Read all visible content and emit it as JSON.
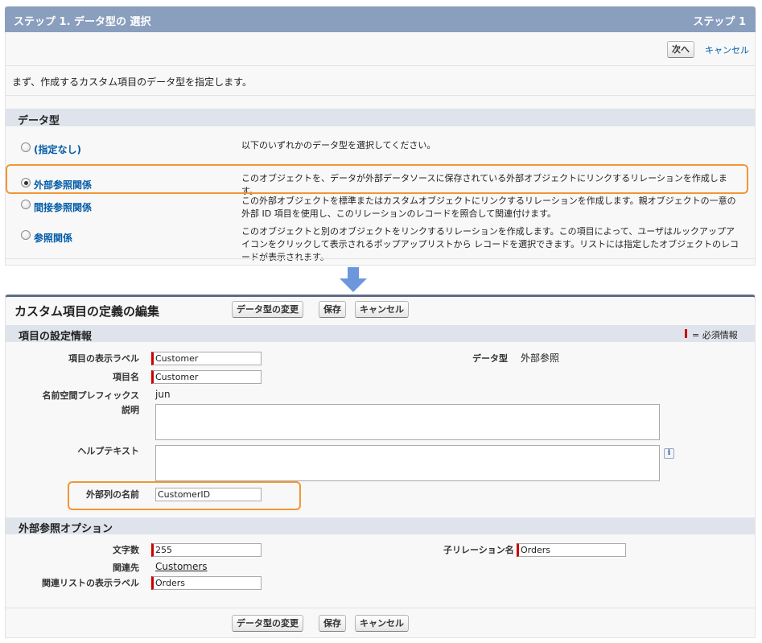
{
  "step": {
    "title": "ステップ 1. データ型の 選択",
    "indicator": "ステップ 1",
    "next_label": "次へ",
    "cancel_label": "キャンセル",
    "intro": "まず、作成するカスタム項目のデータ型を指定します。",
    "section_title": "データ型",
    "options": [
      {
        "label": "(指定なし)",
        "checked": false,
        "desc": "以下のいずれかのデータ型を選択してください。"
      },
      {
        "label": "外部参照関係",
        "checked": true,
        "desc": "このオブジェクトを、データが外部データソースに保存されている外部オブジェクトにリンクするリレーションを作成します。"
      },
      {
        "label": "間接参照関係",
        "checked": false,
        "desc": "この外部オブジェクトを標準またはカスタムオブジェクトにリンクするリレーションを作成します。親オブジェクトの一意の外部 ID 項目を使用し、このリレーションのレコードを照合して関連付けます。"
      },
      {
        "label": "参照関係",
        "checked": false,
        "desc": "このオブジェクトと別のオブジェクトをリンクするリレーションを作成します。この項目によって、ユーザはルックアップアイコンをクリックして表示されるポップアップリストから レコードを選択できます。リストには指定したオブジェクトのレコードが表示されます。"
      }
    ]
  },
  "edit": {
    "title": "カスタム項目の定義の編集",
    "change_type_label": "データ型の変更",
    "save_label": "保存",
    "cancel_label": "キャンセル",
    "settings_section": "項目の設定情報",
    "required_legend": "= 必須情報",
    "field_label_label": "項目の表示ラベル",
    "field_label_value": "Customer",
    "field_name_label": "項目名",
    "field_name_value": "Customer",
    "namespace_label": "名前空間プレフィックス",
    "namespace_value": "jun",
    "description_label": "説明",
    "help_label": "ヘルプテキスト",
    "external_column_label": "外部列の名前",
    "external_column_value": "CustomerID",
    "data_type_label": "データ型",
    "data_type_value": "外部参照",
    "options_section": "外部参照オプション",
    "length_label": "文字数",
    "length_value": "255",
    "related_to_label": "関連先",
    "related_to_value": "Customers",
    "related_list_label": "関連リストの表示ラベル",
    "related_list_value": "Orders",
    "child_relationship_label": "子リレーション名",
    "child_relationship_value": "Orders",
    "info_icon_text": "i"
  },
  "colors": {
    "header": "#8a9ebe",
    "section": "#dfe4ec",
    "highlight": "#f29634",
    "arrow": "#6d97dc",
    "required": "#cc0000",
    "link": "#015ba7"
  }
}
